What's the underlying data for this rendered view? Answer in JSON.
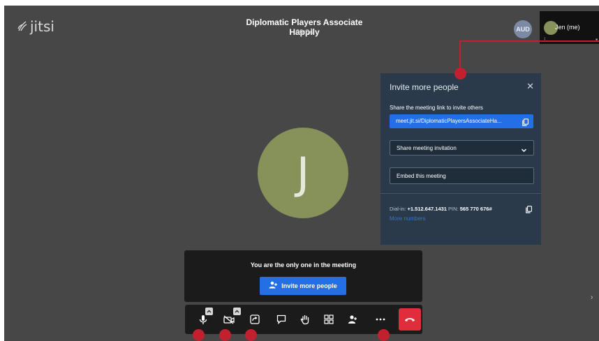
{
  "app": {
    "logo_text": "jitsi",
    "meeting_title": "Diplomatic Players Associate Happily",
    "timer": "00:04"
  },
  "participants": {
    "remote_avatar_initials": "AUD",
    "self_name": "Jen (me)",
    "main_avatar_initial": "J"
  },
  "invite_panel": {
    "title": "Invite more people",
    "subtitle": "Share the meeting link to invite others",
    "meeting_link": "meet.jit.si/DiplomaticPlayersAssociateHa...",
    "share_invitation_label": "Share meeting invitation",
    "embed_label": "Embed this meeting",
    "dialin_label": "Dial-in:",
    "dialin_number": "+1.512.647.1431",
    "pin_label": "PIN:",
    "pin": "565 770 676#",
    "more_numbers": "More numbers"
  },
  "notice": {
    "text": "You are the only one in the meeting",
    "invite_button_label": "Invite more people"
  },
  "toolbar": {
    "buttons": [
      "microphone",
      "camera-off",
      "screen-share",
      "chat",
      "raise-hand",
      "tile-view",
      "participants",
      "more-actions",
      "hang-up"
    ]
  },
  "colors": {
    "stage_bg": "#474747",
    "panel_bg": "#2a3a4b",
    "primary_blue": "#246fe5",
    "hangup_red": "#e02d3c",
    "annotation_red": "#c2202f",
    "avatar_green": "#87915a"
  }
}
